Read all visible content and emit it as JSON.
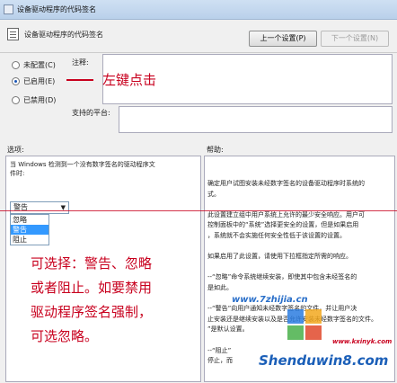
{
  "window": {
    "title": "设备驱动程序的代码签名"
  },
  "header": {
    "title": "设备驱动程序的代码签名",
    "prev_button": "上一个设置(P)",
    "next_button": "下一个设置(N)"
  },
  "state": {
    "options": [
      {
        "label": "未配置(C)",
        "selected": false
      },
      {
        "label": "已启用(E)",
        "selected": true
      },
      {
        "label": "已禁用(D)",
        "selected": false
      }
    ],
    "comment_label": "注释:",
    "platform_label": "支持的平台:"
  },
  "annotation_click": "左键点击",
  "sections": {
    "options_label": "选项:",
    "help_label": "帮助:"
  },
  "options_panel": {
    "description_line1": "当 Windows 检测到一个没有数字签名的驱动程序文",
    "description_line2": "件时:",
    "dropdown_value": "警告",
    "dropdown_options": [
      {
        "label": "忽略",
        "selected": false
      },
      {
        "label": "警告",
        "selected": true
      },
      {
        "label": "阻止",
        "selected": false
      }
    ]
  },
  "annotation_choose": [
    "可选择：警告、忽略",
    "或者阻止。如要禁用",
    "驱动程序签名强制，",
    "可选忽略。"
  ],
  "help": {
    "lines": [
      "确定用户试图安装未经数字签名的设备驱动程序时系统的",
      "式。",
      "",
      "此设置建立组中用户系统上允许的最少安全响应。用户可",
      "控制面板中的“系统”选择更安全的设置，但是如果启用",
      "，系统就不会实施任何安全性低于该设置的设置。",
      "",
      "如果启用了此设置，请使用下拉框指定所需的响应。",
      "",
      "--“忽略”命令系统继续安装，即使其中包含未经签名的",
      "是如此。",
      "",
      "--“警告”向用户通知未经数字签名的文件，并让用户决",
      "止安装还是继续安装以及是否允许安装未经数字签名的文件。",
      "”是默认设置。",
      "",
      "--“阻止”",
      "停止，而"
    ]
  },
  "watermark": {
    "site1": "www.7zhijia.cn",
    "site2": "Shenduwin8.com",
    "site3": "www.kxinyk.com"
  }
}
